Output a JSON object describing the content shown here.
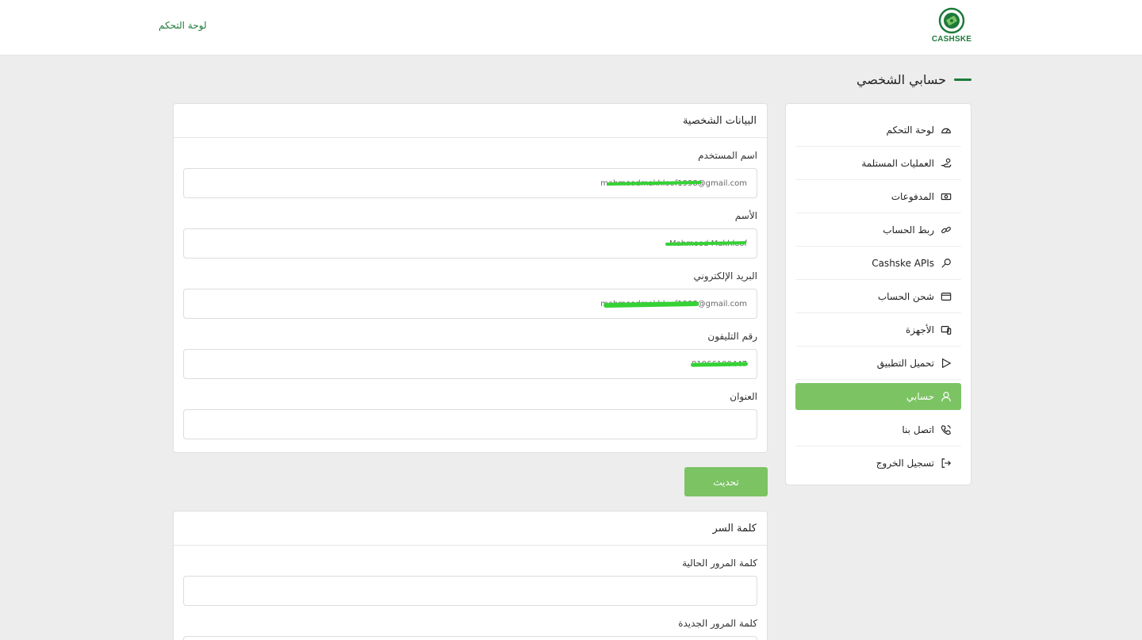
{
  "header": {
    "logo_text": "CASHSKE",
    "dashboard_link": "لوحة التحكم"
  },
  "page": {
    "title": "حسابي الشخصي"
  },
  "sidebar": {
    "items": [
      {
        "label": "لوحة التحكم",
        "icon": "gauge-icon"
      },
      {
        "label": "العمليات المستلمة",
        "icon": "hand-money-icon"
      },
      {
        "label": "المدفوعات",
        "icon": "cash-icon"
      },
      {
        "label": "ربط الحساب",
        "icon": "link-icon"
      },
      {
        "label": "Cashske APIs",
        "icon": "key-icon"
      },
      {
        "label": "شحن الحساب",
        "icon": "wallet-icon"
      },
      {
        "label": "الأجهزة",
        "icon": "devices-icon"
      },
      {
        "label": "تحميل التطبيق",
        "icon": "play-icon"
      },
      {
        "label": "حسابي",
        "icon": "user-icon",
        "active": true
      },
      {
        "label": "اتصل بنا",
        "icon": "phone-icon"
      },
      {
        "label": "تسجيل الخروج",
        "icon": "logout-icon"
      }
    ]
  },
  "personal": {
    "title": "البيانات الشخصية",
    "username_label": "اسم المستخدم",
    "username_value": "mahmoodmakhloof1998@gmail.com",
    "name_label": "الأسم",
    "name_value": "Mahmood Makhloof",
    "email_label": "البريد الإلكتروني",
    "email_value": "mahmoodmakhloof1998@gmail.com",
    "phone_label": "رقم التليفون",
    "phone_value": "01066100447",
    "address_label": "العنوان",
    "address_value": "",
    "update_label": "تحديث"
  },
  "password": {
    "title": "كلمة السر",
    "current_label": "كلمة المرور الحالية",
    "new_label": "كلمة المرور الجديدة"
  },
  "colors": {
    "brand": "#1d7a3a",
    "accent": "#7cc363",
    "redaction": "#35d235"
  }
}
